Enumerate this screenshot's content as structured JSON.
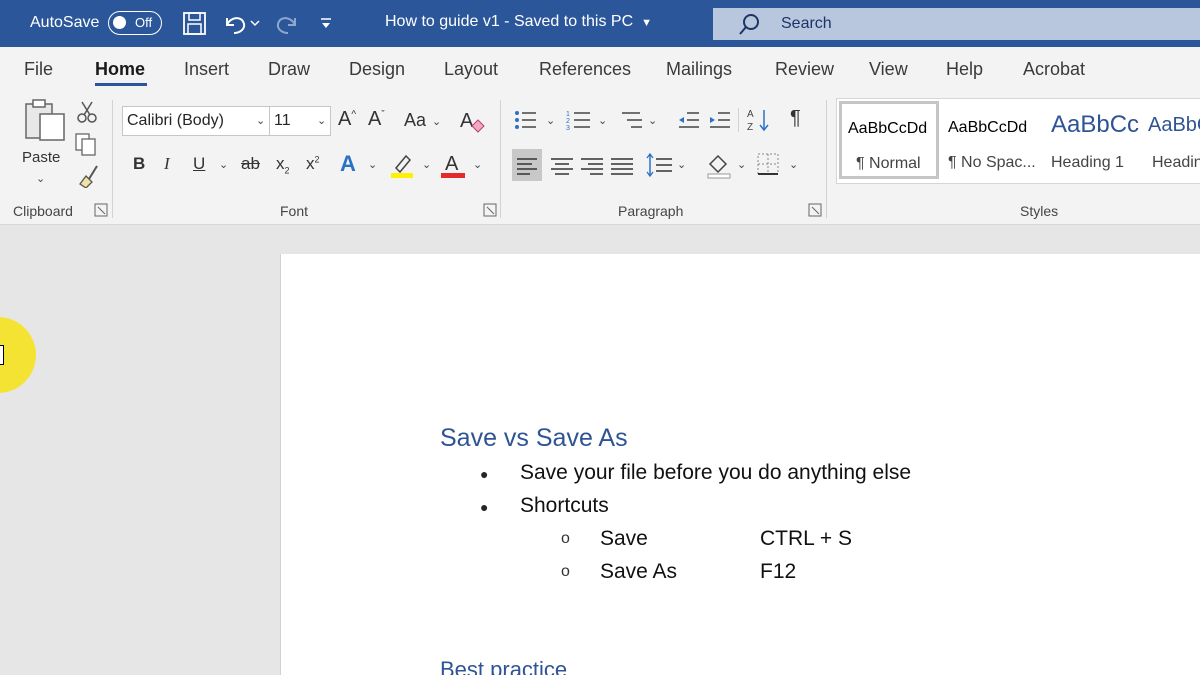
{
  "titlebar": {
    "autosave_label": "AutoSave",
    "autosave_state": "Off",
    "doc_title": "How to guide v1  -  Saved to this PC",
    "search_label": "Search"
  },
  "tabs": [
    "File",
    "Home",
    "Insert",
    "Draw",
    "Design",
    "Layout",
    "References",
    "Mailings",
    "Review",
    "View",
    "Help",
    "Acrobat"
  ],
  "active_tab": "Home",
  "ribbon": {
    "clipboard": {
      "paste_label": "Paste",
      "group_label": "Clipboard"
    },
    "font": {
      "font_name": "Calibri (Body)",
      "font_size": "11",
      "aa_label": "Aa",
      "bold": "B",
      "italic": "I",
      "underline": "U",
      "strike": "ab",
      "sub": "x",
      "sup": "x",
      "color_a": "A",
      "group_label": "Font"
    },
    "paragraph": {
      "group_label": "Paragraph"
    },
    "styles": {
      "group_label": "Styles",
      "items": [
        {
          "sample": "AaBbCcDd",
          "name": "¶ Normal"
        },
        {
          "sample": "AaBbCcDd",
          "name": "¶ No Spac..."
        },
        {
          "sample": "AaBbCc",
          "name": "Heading 1"
        },
        {
          "sample": "AaBbC",
          "name": "Headin"
        }
      ]
    }
  },
  "document": {
    "heading1": "Save vs Save As",
    "bullets": [
      "Save your file before you do anything else",
      "Shortcuts"
    ],
    "sub_items": [
      {
        "label": "Save",
        "shortcut": "CTRL + S"
      },
      {
        "label": "Save As",
        "shortcut": "F12"
      }
    ],
    "heading2": "Best practice"
  },
  "colors": {
    "titlebar": "#2b579a",
    "heading": "#2f5496",
    "cursor_highlight": "#f6e32a"
  }
}
